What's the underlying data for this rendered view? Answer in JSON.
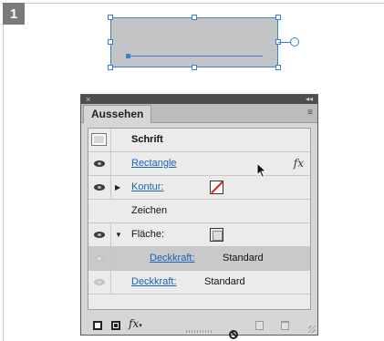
{
  "step": {
    "number": "1"
  },
  "panel": {
    "close_glyph": "×",
    "collapse_glyph": "◂◂",
    "tab_label": "Aussehen",
    "menu_glyph": "≡"
  },
  "rows": {
    "schrift": "Schrift",
    "rectangle": "Rectangle",
    "fx": "fx",
    "kontur": "Kontur:",
    "zeichen": "Zeichen",
    "flaeche": "Fläche:",
    "deckkraft_inner_label": "Deckkraft:",
    "deckkraft_inner_value": "Standard",
    "deckkraft_outer_label": "Deckkraft:",
    "deckkraft_outer_value": "Standard"
  },
  "bottom_bar": {
    "fx_label": "fx"
  },
  "icons": [
    "eye-icon",
    "disclosure-triangle-icon",
    "stroke-swatch-icon",
    "fill-swatch-icon",
    "no-icon",
    "duplicate-icon",
    "trash-icon",
    "cursor-icon"
  ],
  "colors": {
    "accent_selection": "#3a7fd0",
    "link": "#1a63b8",
    "stroke_red": "#dd2222"
  }
}
